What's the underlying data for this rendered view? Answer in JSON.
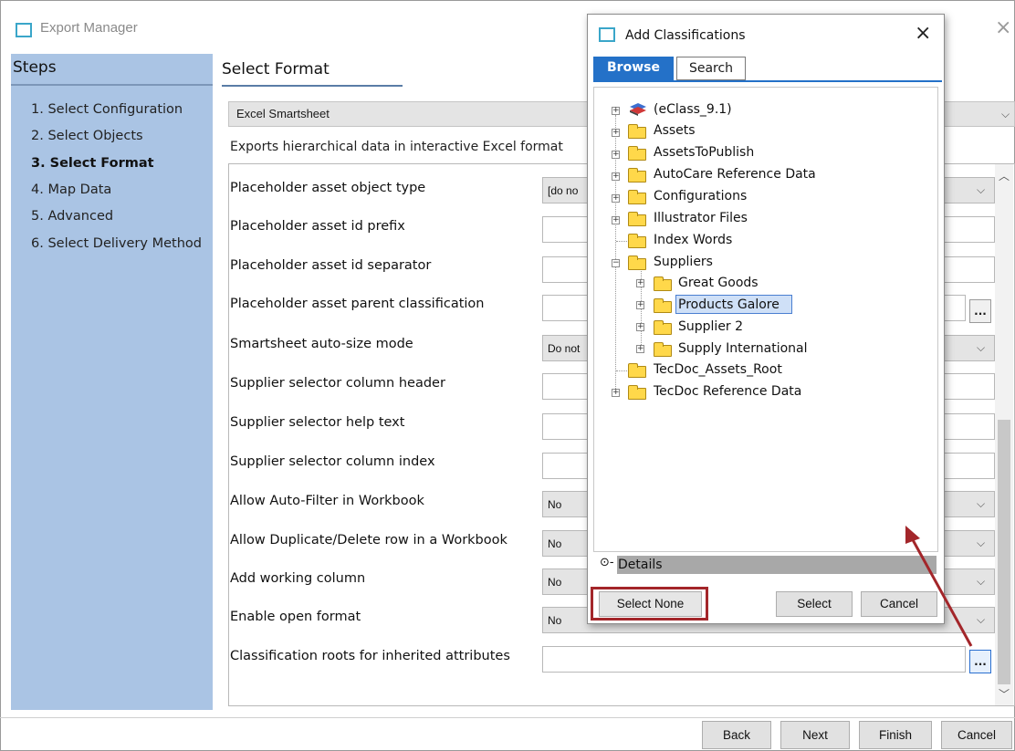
{
  "window": {
    "title": "Export Manager",
    "close_glyph": "×"
  },
  "steps": {
    "title": "Steps",
    "items": [
      {
        "label": "1. Select Configuration"
      },
      {
        "label": "2. Select Objects"
      },
      {
        "label": "3. Select Format",
        "current": true
      },
      {
        "label": "4. Map Data"
      },
      {
        "label": "5. Advanced"
      },
      {
        "label": "6. Select Delivery Method"
      }
    ]
  },
  "main": {
    "section_title": "Select Format",
    "format_value": "Excel Smartsheet",
    "description": "Exports hierarchical data in interactive Excel format",
    "properties": [
      {
        "label": "Placeholder asset object type",
        "type": "dropdown",
        "value": "[do no"
      },
      {
        "label": "Placeholder asset id prefix",
        "type": "text",
        "value": ""
      },
      {
        "label": "Placeholder asset id separator",
        "type": "text",
        "value": ""
      },
      {
        "label": "Placeholder asset parent classification",
        "type": "text-browse",
        "value": ""
      },
      {
        "label": "Smartsheet auto-size mode",
        "type": "dropdown",
        "value": "Do not"
      },
      {
        "label": "Supplier selector column header",
        "type": "text",
        "value": ""
      },
      {
        "label": "Supplier selector help text",
        "type": "text",
        "value": ""
      },
      {
        "label": "Supplier selector column index",
        "type": "text",
        "value": ""
      },
      {
        "label": "Allow Auto-Filter in Workbook",
        "type": "dropdown",
        "value": "No"
      },
      {
        "label": "Allow Duplicate/Delete row in a Workbook",
        "type": "dropdown",
        "value": "No"
      },
      {
        "label": "Add working column",
        "type": "dropdown",
        "value": "No"
      },
      {
        "label": "Enable open format",
        "type": "dropdown",
        "value": "No"
      },
      {
        "label": "Classification roots for inherited attributes",
        "type": "text-browse",
        "value": ""
      }
    ],
    "browse_label": "..."
  },
  "footer": {
    "back": "Back",
    "next": "Next",
    "finish": "Finish",
    "cancel": "Cancel"
  },
  "dialog": {
    "title": "Add Classifications",
    "close_glyph": "×",
    "tabs": {
      "browse": "Browse",
      "search": "Search"
    },
    "tree": [
      {
        "label": "(eClass_9.1)",
        "level": 0,
        "expander": "+",
        "icon": "eclass-stack-icon"
      },
      {
        "label": "Assets",
        "level": 0,
        "expander": "+",
        "icon": "folder-icon"
      },
      {
        "label": "AssetsToPublish",
        "level": 0,
        "expander": "+",
        "icon": "folder-icon"
      },
      {
        "label": "AutoCare Reference Data",
        "level": 0,
        "expander": "+",
        "icon": "folder-icon"
      },
      {
        "label": "Configurations",
        "level": 0,
        "expander": "+",
        "icon": "folder-icon"
      },
      {
        "label": "Illustrator Files",
        "level": 0,
        "expander": "+",
        "icon": "folder-icon"
      },
      {
        "label": "Index Words",
        "level": 0,
        "expander": "",
        "icon": "folder-icon"
      },
      {
        "label": "Suppliers",
        "level": 0,
        "expander": "−",
        "icon": "folder-icon"
      },
      {
        "label": "Great Goods",
        "level": 1,
        "expander": "+",
        "icon": "folder-icon"
      },
      {
        "label": "Products Galore",
        "level": 1,
        "expander": "+",
        "icon": "folder-icon",
        "selected": true
      },
      {
        "label": "Supplier 2",
        "level": 1,
        "expander": "+",
        "icon": "folder-icon"
      },
      {
        "label": "Supply International",
        "level": 1,
        "expander": "+",
        "icon": "folder-icon"
      },
      {
        "label": "TecDoc_Assets_Root",
        "level": 0,
        "expander": "",
        "icon": "folder-icon"
      },
      {
        "label": "TecDoc Reference Data",
        "level": 0,
        "expander": "+",
        "icon": "folder-icon"
      }
    ],
    "details_label": "Details",
    "details_icon_glyph": "⊙-",
    "buttons": {
      "select_none": "Select None",
      "select": "Select",
      "cancel": "Cancel"
    }
  },
  "annotation": {
    "highlight_color": "#a3262a",
    "arrow_color": "#a3262a"
  }
}
